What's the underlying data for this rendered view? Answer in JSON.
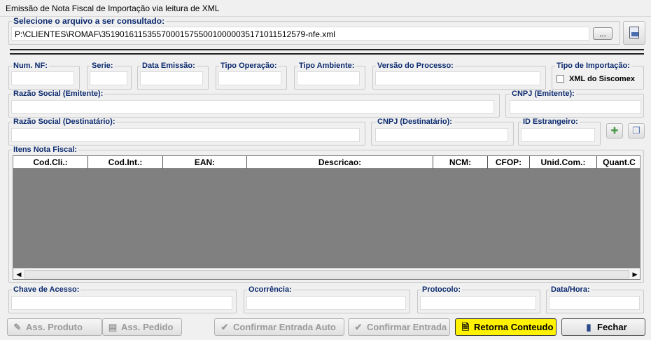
{
  "window": {
    "title": "Emissão de Nota Fiscal de Importação via leitura de XML"
  },
  "file": {
    "label": "Selecione o arquivo a ser consultado:",
    "path": "P:\\CLIENTES\\ROMAF\\35190161153557000157550010000035171011512579-nfe.xml",
    "browse_label": "..."
  },
  "header_fields": {
    "num_nf": "Num. NF:",
    "serie": "Serie:",
    "data_emissao": "Data Emissão:",
    "tipo_operacao": "Tipo Operação:",
    "tipo_ambiente": "Tipo Ambiente:",
    "versao_processo": "Versão do Processo:",
    "tipo_importacao": "Tipo de Importação:",
    "xml_siscomex": "XML do Siscomex"
  },
  "emitente": {
    "razao_label": "Razão Social (Emitente):",
    "cnpj_label": "CNPJ (Emitente):"
  },
  "destinatario": {
    "razao_label": "Razão Social (Destinatário):",
    "cnpj_label": "CNPJ (Destinatário):",
    "id_estrangeiro_label": "ID Estrangeiro:"
  },
  "itens": {
    "label": "Itens Nota Fiscal:",
    "columns": [
      "Cod.Cli.:",
      "Cod.Int.:",
      "EAN:",
      "Descricao:",
      "NCM:",
      "CFOP:",
      "Unid.Com.:",
      "Quant.C"
    ]
  },
  "footer_fields": {
    "chave": "Chave de Acesso:",
    "ocorrencia": "Ocorrência:",
    "protocolo": "Protocolo:",
    "data_hora": "Data/Hora:"
  },
  "buttons": {
    "ass_produto": "Ass. Produto",
    "ass_pedido": "Ass. Pedido",
    "confirmar_auto": "Confirmar Entrada Auto",
    "confirmar": "Confirmar Entrada",
    "retorna": "Retorna Conteudo",
    "fechar": "Fechar"
  },
  "colors": {
    "label_blue": "#0c2a6e",
    "highlight_yellow": "#fff200",
    "grid_body": "#808080"
  }
}
